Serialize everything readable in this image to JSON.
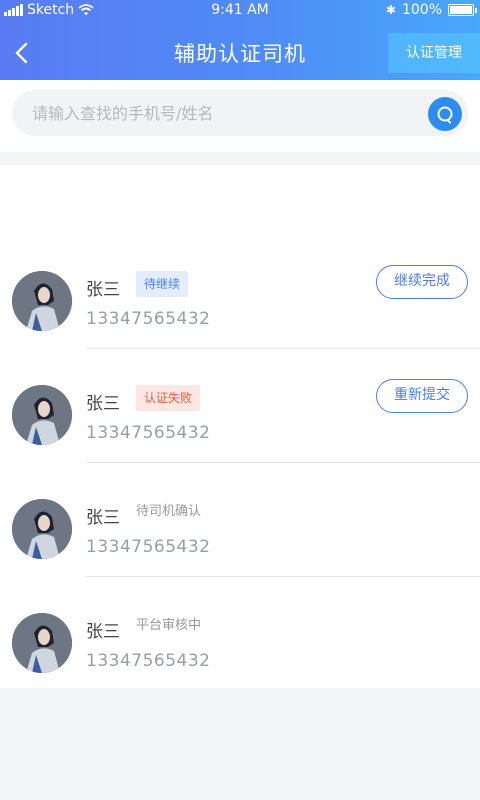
{
  "status_bar": {
    "carrier": "Sketch",
    "time": "9:41 AM",
    "battery": "100%"
  },
  "header": {
    "title": "辅助认证司机",
    "manage_label": "认证管理",
    "gradient_start": "#5a7bf3",
    "gradient_end": "#48a8fb"
  },
  "search": {
    "placeholder": "请输入查找的手机号/姓名",
    "value": ""
  },
  "drivers": [
    {
      "name": "张三",
      "phone": "13347565432",
      "status": "待继续",
      "status_style": "pending",
      "action": "继续完成"
    },
    {
      "name": "张三",
      "phone": "13347565432",
      "status": "认证失败",
      "status_style": "failed",
      "action": "重新提交"
    },
    {
      "name": "张三",
      "phone": "13347565432",
      "status": "待司机确认",
      "status_style": "plain",
      "action": ""
    },
    {
      "name": "张三",
      "phone": "13347565432",
      "status": "平台审核中",
      "status_style": "plain",
      "action": ""
    }
  ],
  "colors": {
    "accent": "#2d8cf0",
    "pending": "#4a7ee8",
    "failed": "#f05a3a"
  }
}
